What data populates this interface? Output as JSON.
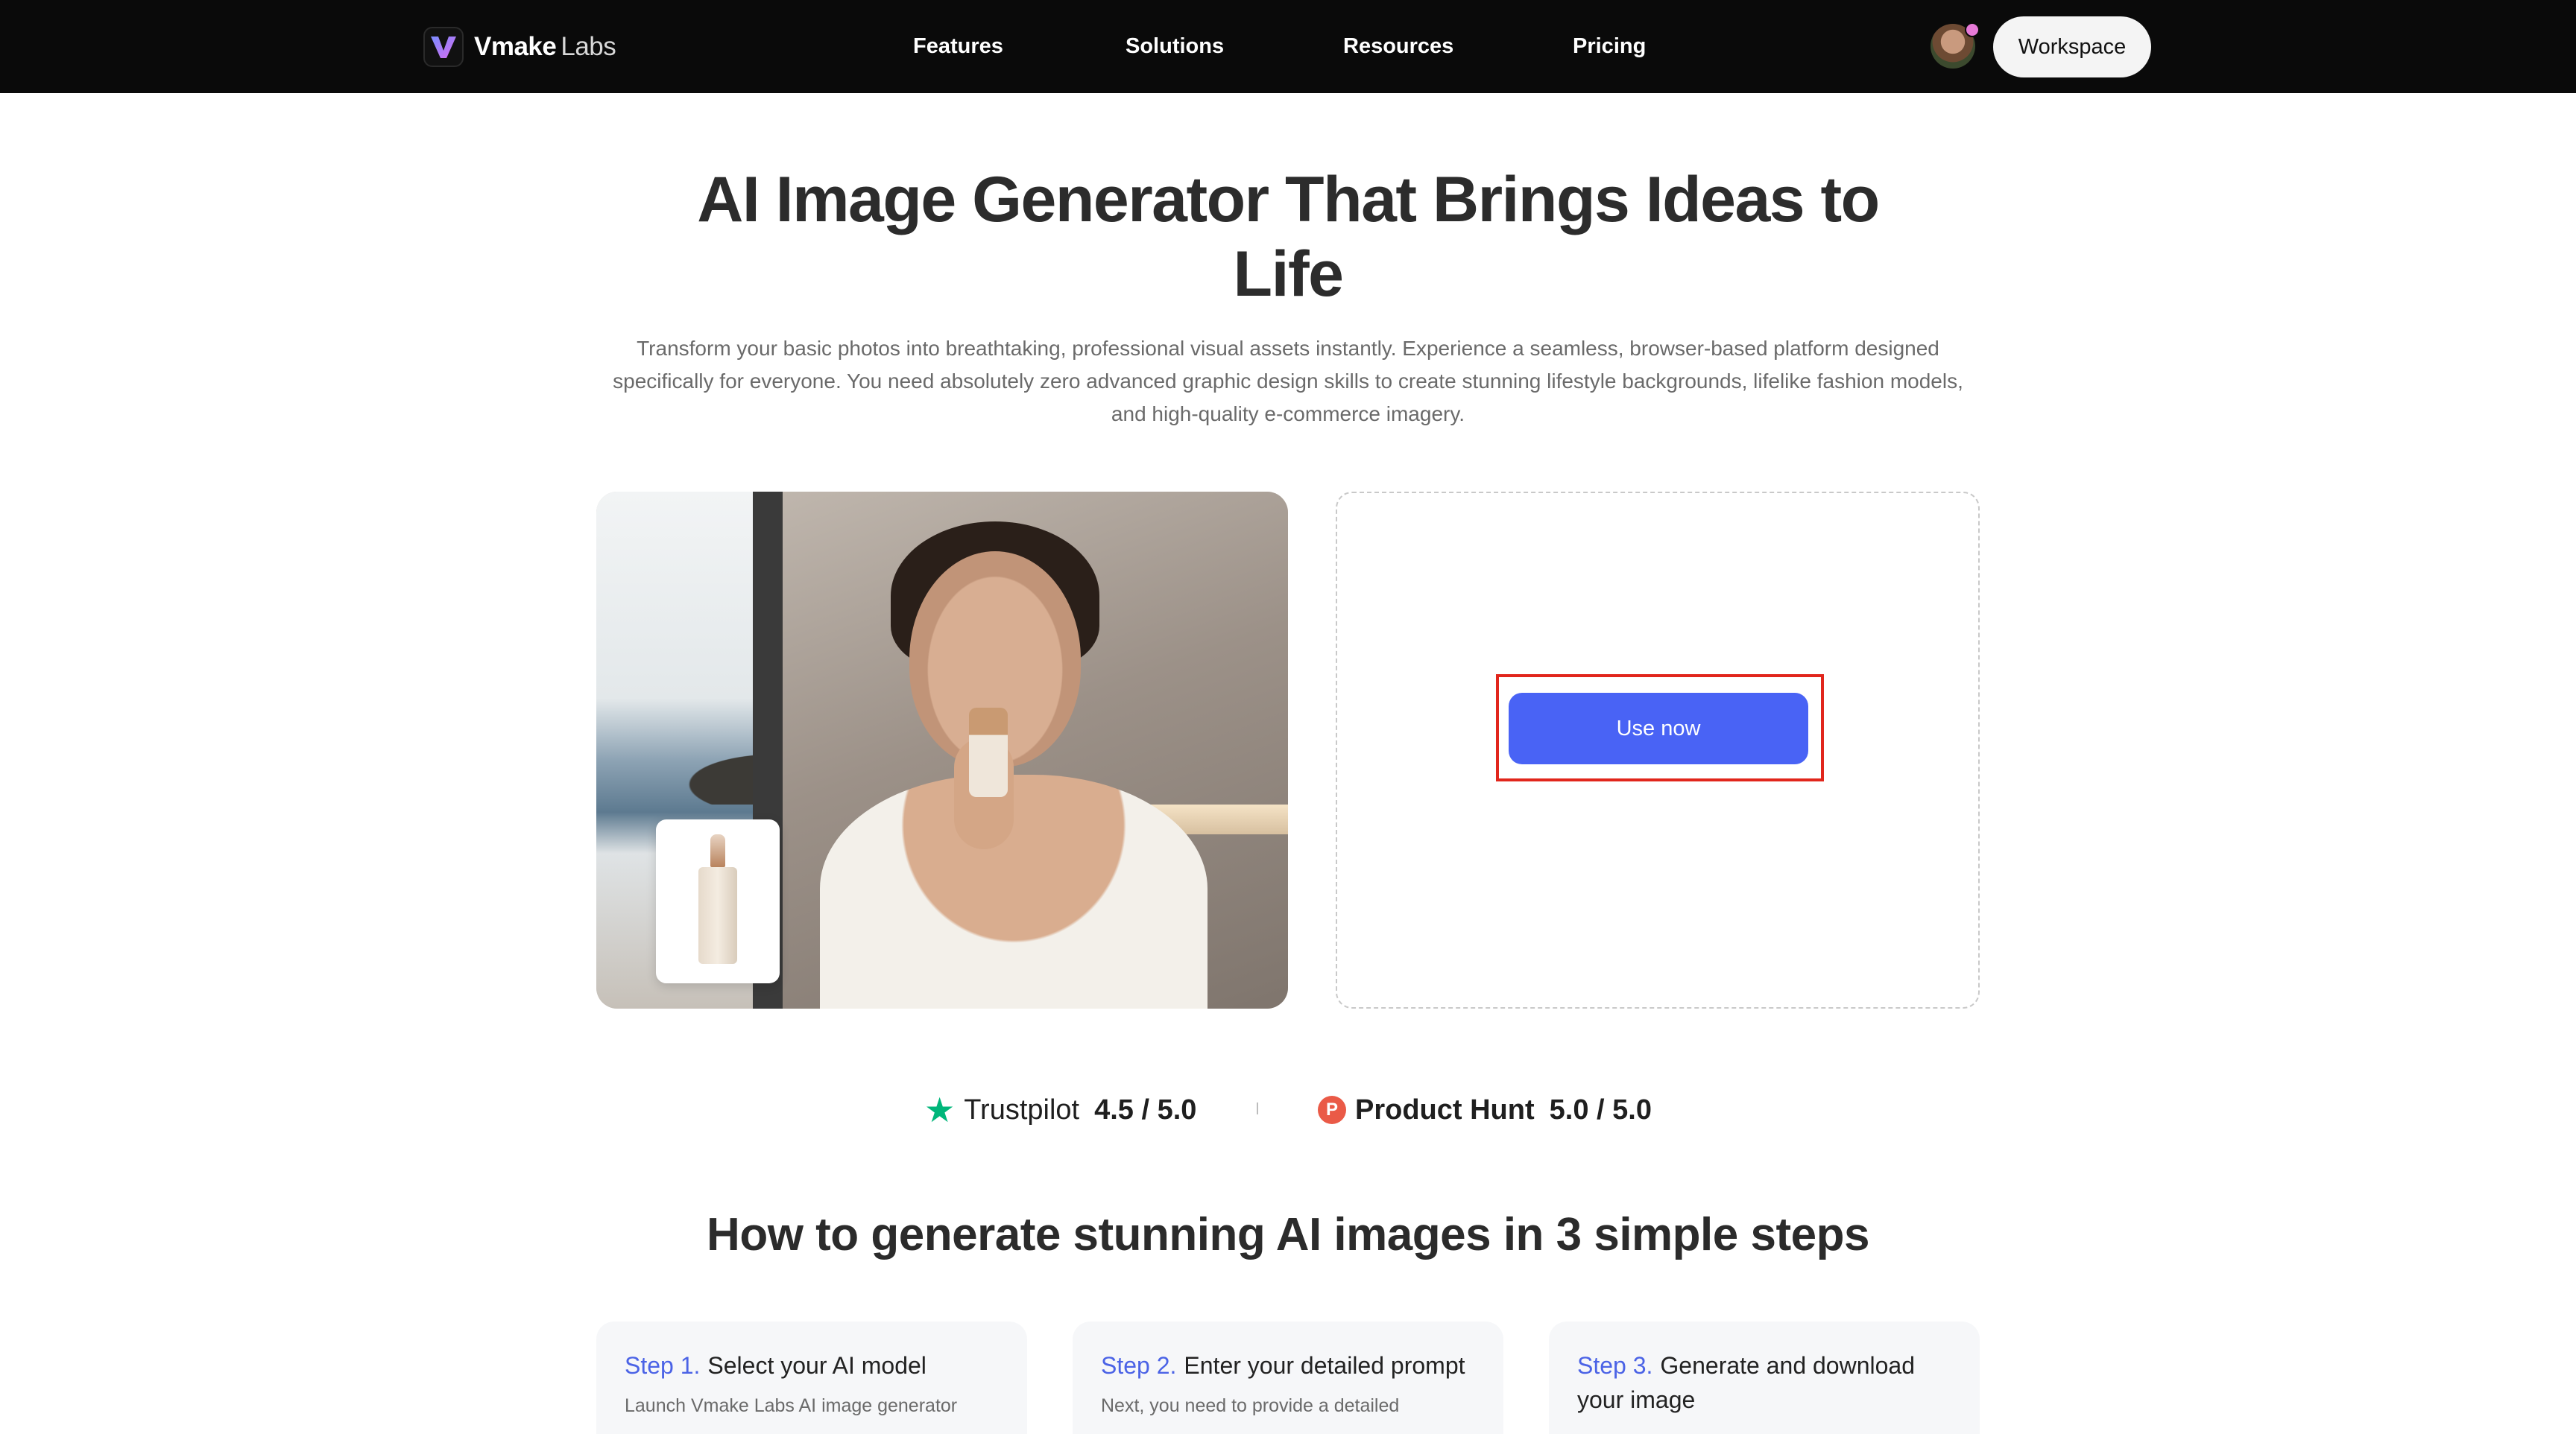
{
  "nav": {
    "logo_primary": "Vmake",
    "logo_secondary": "Labs",
    "links": [
      "Features",
      "Solutions",
      "Resources",
      "Pricing"
    ],
    "workspace_label": "Workspace"
  },
  "hero": {
    "title": "AI Image Generator That Brings Ideas to Life",
    "description": "Transform your basic photos into breathtaking, professional visual assets instantly. Experience a seamless, browser-based platform designed specifically for everyone. You need absolutely zero advanced graphic design skills to create stunning lifestyle backgrounds, lifelike fashion models, and high-quality e-commerce imagery."
  },
  "panel": {
    "use_now_label": "Use now"
  },
  "ratings": [
    {
      "name": "Trustpilot",
      "score": "4.5 / 5.0",
      "icon": "star-icon"
    },
    {
      "name": "Product Hunt",
      "score": "5.0 / 5.0",
      "icon": "product-hunt-icon",
      "icon_letter": "P"
    }
  ],
  "steps": {
    "title": "How to generate stunning AI images in 3 simple steps",
    "items": [
      {
        "number": "Step 1.",
        "title": "Select your AI model",
        "description": "Launch Vmake Labs AI image generator"
      },
      {
        "number": "Step 2.",
        "title": "Enter your detailed prompt",
        "description": "Next, you need to provide a detailed"
      },
      {
        "number": "Step 3.",
        "title": "Generate and download your image",
        "description": ""
      }
    ]
  },
  "colors": {
    "nav_bg": "#0a0a0a",
    "accent_blue": "#4963f5",
    "step_number": "#4b63e6",
    "highlight_red": "#e1261c",
    "trustpilot_green": "#00b67a",
    "product_hunt_red": "#ea5a47"
  }
}
